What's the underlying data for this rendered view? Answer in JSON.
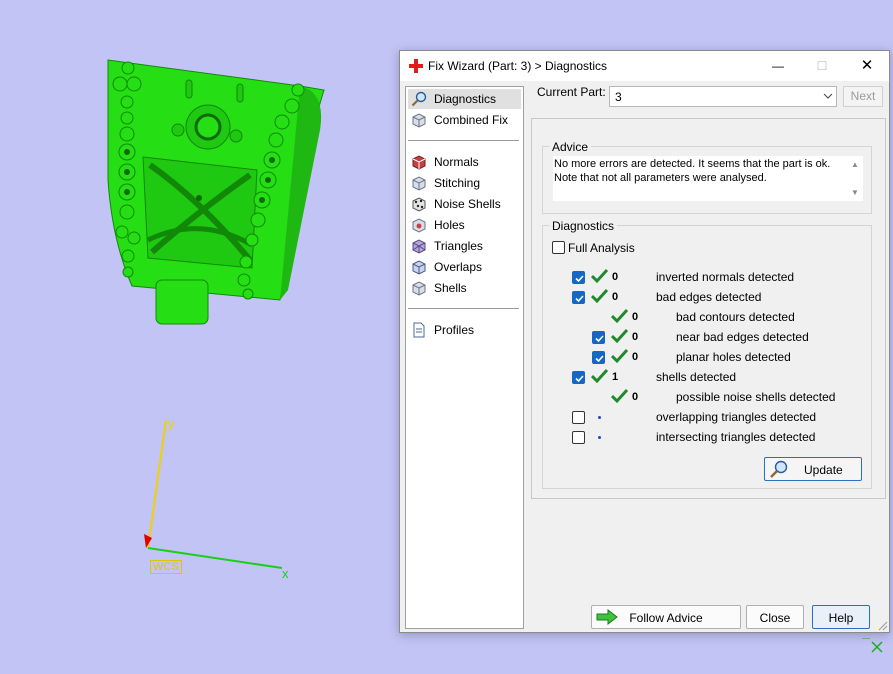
{
  "viewport": {
    "axis_y_label": "y",
    "axis_x_label": "x",
    "wcs_label": "WCS"
  },
  "dialog": {
    "title": "Fix Wizard (Part: 3) > Diagnostics",
    "window_controls": {
      "minimize": "—",
      "maximize": "☐",
      "close": "✕"
    }
  },
  "sidebar": {
    "items": [
      {
        "label": "Diagnostics",
        "icon": "magnifier-icon",
        "active": true
      },
      {
        "label": "Combined Fix",
        "icon": "cube-icon"
      },
      {
        "label": "Normals",
        "icon": "normals-cube-icon"
      },
      {
        "label": "Stitching",
        "icon": "stitching-cube-icon"
      },
      {
        "label": "Noise Shells",
        "icon": "noise-shells-icon"
      },
      {
        "label": "Holes",
        "icon": "holes-cube-icon"
      },
      {
        "label": "Triangles",
        "icon": "triangles-cube-icon"
      },
      {
        "label": "Overlaps",
        "icon": "overlaps-cube-icon"
      },
      {
        "label": "Shells",
        "icon": "shells-cube-icon"
      },
      {
        "label": "Profiles",
        "icon": "profiles-document-icon"
      }
    ]
  },
  "current_part": {
    "label": "Current Part:",
    "value": "3",
    "next_label": "Next"
  },
  "advice": {
    "title": "Advice",
    "text": "No more errors are detected. It seems that the part is ok. Note that not all parameters were analysed."
  },
  "diagnostics": {
    "title": "Diagnostics",
    "full_analysis_label": "Full Analysis",
    "full_analysis_checked": false,
    "rows": [
      {
        "checked": true,
        "status": "ok",
        "count": "0",
        "label": "inverted normals detected"
      },
      {
        "checked": true,
        "status": "ok",
        "count": "0",
        "label": "bad edges detected"
      },
      {
        "checked": null,
        "status": "ok",
        "count": "0",
        "label": "bad contours detected"
      },
      {
        "checked": true,
        "status": "ok",
        "count": "0",
        "label": "near bad edges detected"
      },
      {
        "checked": true,
        "status": "ok",
        "count": "0",
        "label": "planar holes detected"
      },
      {
        "checked": true,
        "status": "ok",
        "count": "1",
        "label": "shells detected"
      },
      {
        "checked": null,
        "status": "ok",
        "count": "0",
        "label": "possible noise shells detected"
      },
      {
        "checked": false,
        "status": "none",
        "count": "",
        "label": "overlapping triangles detected"
      },
      {
        "checked": false,
        "status": "none",
        "count": "",
        "label": "intersecting triangles detected"
      }
    ],
    "update_label": "Update"
  },
  "footer": {
    "follow_advice_label": "Follow Advice",
    "close_label": "Close",
    "help_label": "Help"
  },
  "colors": {
    "model_green": "#22dd11",
    "accent_blue": "#1467c4",
    "check_green": "#1f8a2a"
  }
}
